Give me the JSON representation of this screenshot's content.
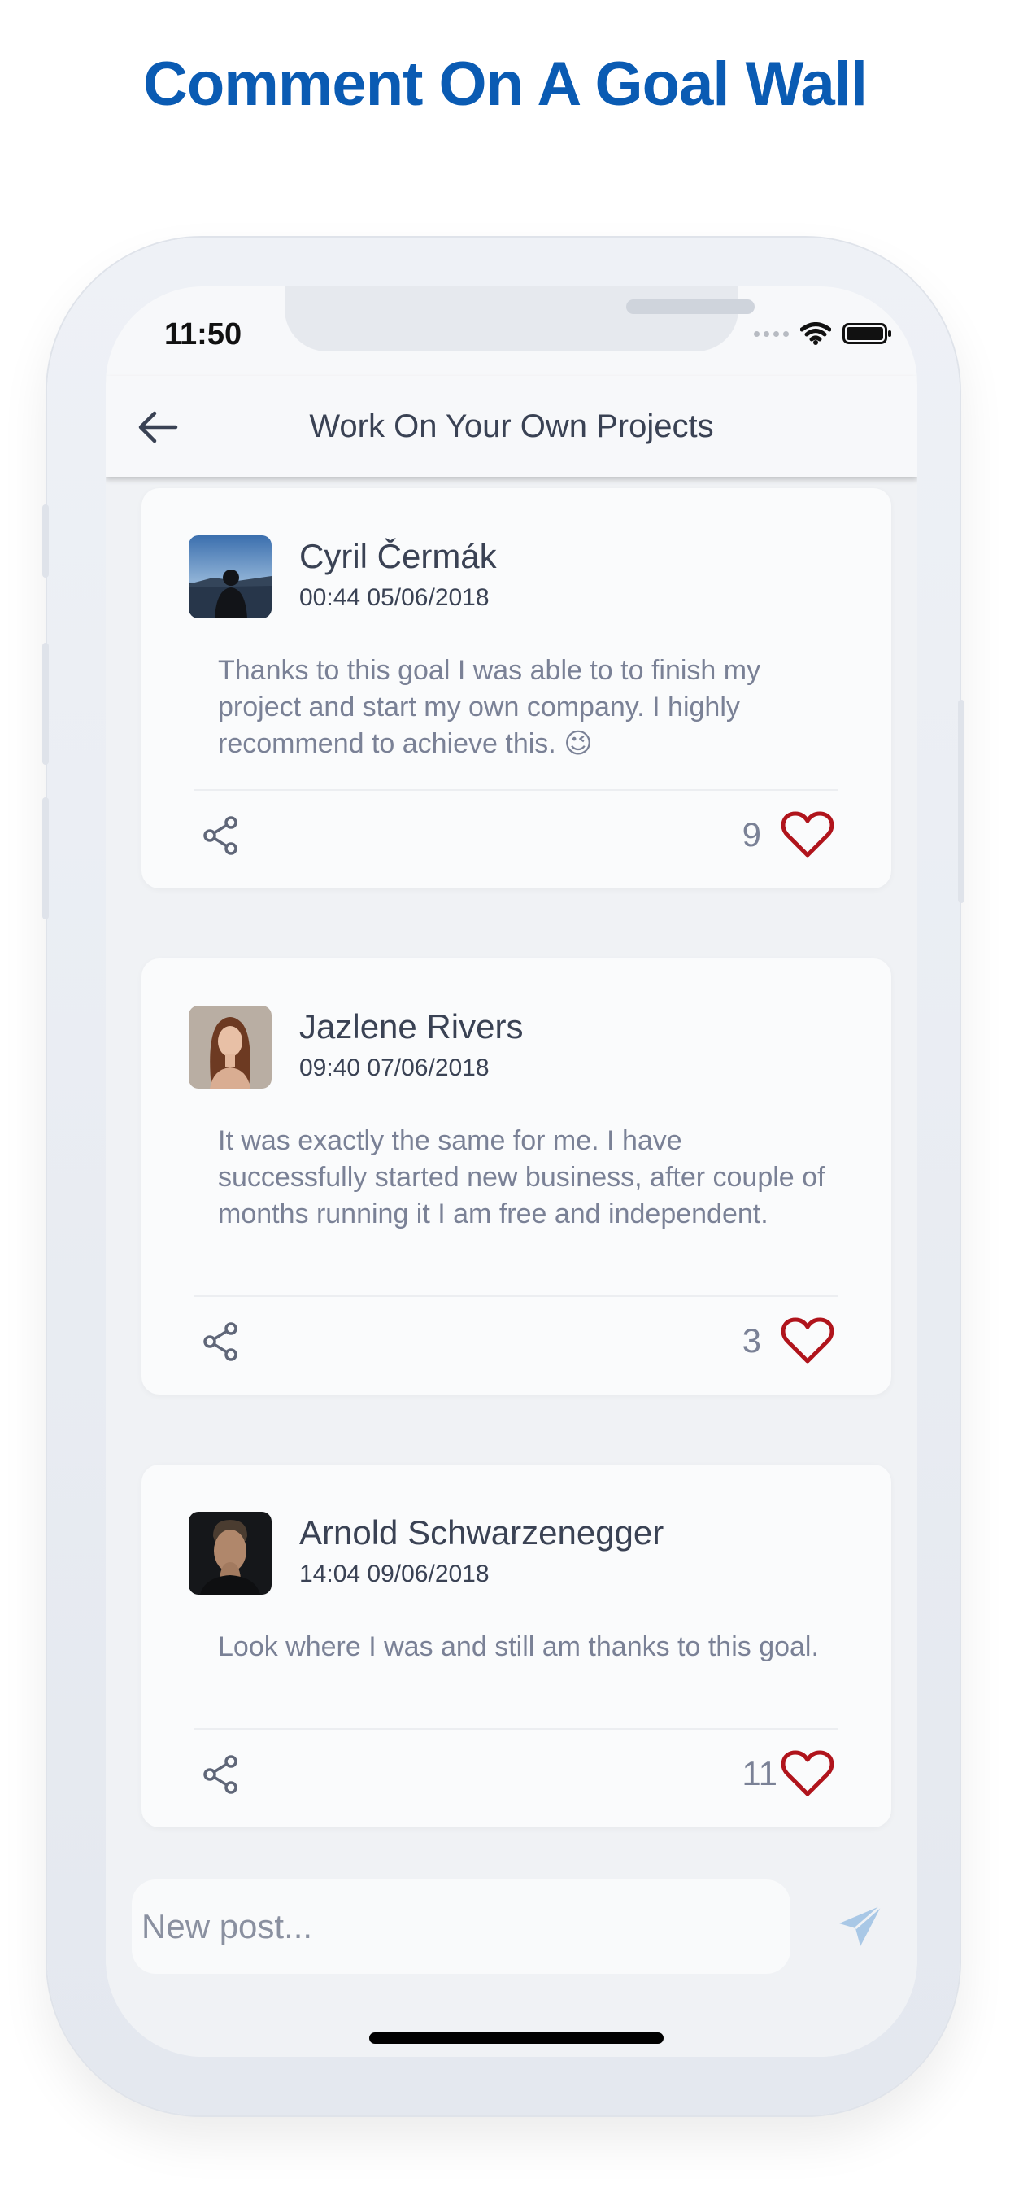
{
  "headline": "Comment On A Goal Wall",
  "status_bar": {
    "time": "11:50"
  },
  "header": {
    "title": "Work On Your Own Projects"
  },
  "posts": [
    {
      "author": "Cyril Čermák",
      "timestamp": "00:44 05/06/2018",
      "text": "Thanks to this goal I was able to to finish my project and start my own company. I highly recommend to achieve this. 😉",
      "likes": "9"
    },
    {
      "author": "Jazlene Rivers",
      "timestamp": "09:40 07/06/2018",
      "text": "It was exactly the same for me. I have successfully started new business, after couple of months running it I am free and independent.",
      "likes": "3"
    },
    {
      "author": "Arnold Schwarzenegger",
      "timestamp": "14:04 09/06/2018",
      "text": "Look where I was and still am thanks to this goal.",
      "likes": "11"
    }
  ],
  "composer": {
    "placeholder": "New post..."
  },
  "colors": {
    "headline": "#0a5bb3",
    "heart": "#b0141c",
    "text": "#3a4254",
    "muted": "#7a8196",
    "send": "#a9c8e6"
  }
}
